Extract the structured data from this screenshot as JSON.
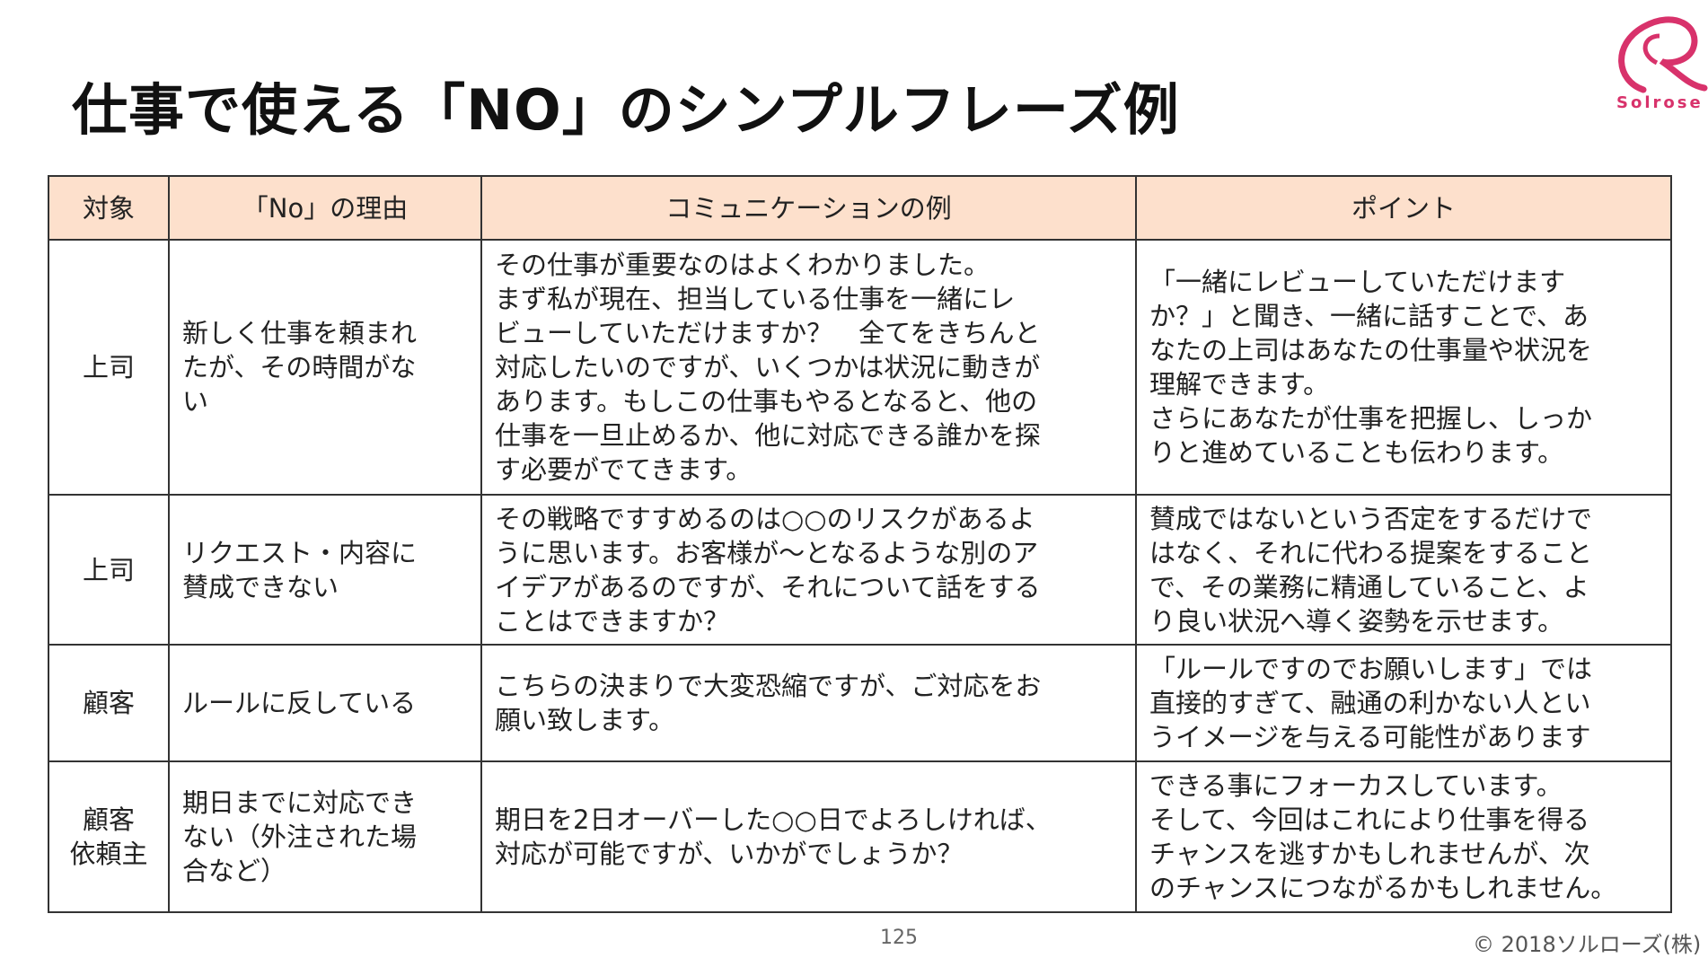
{
  "title": "仕事で使える「NO」のシンプルフレーズ例",
  "logo": {
    "text": "Solrose",
    "color": "#d8326b"
  },
  "table": {
    "header_bg": "#fde0cc",
    "headers": [
      "対象",
      "「No」の理由",
      "コミュニケーションの例",
      "ポイント"
    ],
    "rows": [
      [
        "上司",
        "新しく仕事を頼まれ\nたが、その時間がな\nい",
        "その仕事が重要なのはよくわかりました。\nまず私が現在、担当している仕事を一緒にレ\nビューしていただけますか？　全てをきちんと\n対応したいのですが、いくつかは状況に動きが\nあります。もしこの仕事もやるとなると、他の\n仕事を一旦止めるか、他に対応できる誰かを探\nす必要がでてきます。",
        "「一緒にレビューしていただけます\nか？」と聞き、一緒に話すことで、あ\nなたの上司はあなたの仕事量や状況を\n理解できます。\nさらにあなたが仕事を把握し、しっか\nりと進めていることも伝わります。"
      ],
      [
        "上司",
        "リクエスト・内容に\n賛成できない",
        "その戦略ですすめるのは○○のリスクがあるよ\nうに思います。お客様が～となるような別のア\nイデアがあるのですが、それについて話をする\nことはできますか？",
        "賛成ではないという否定をするだけで\nはなく、それに代わる提案をすること\nで、その業務に精通していること、よ\nり良い状況へ導く姿勢を示せます。"
      ],
      [
        "顧客",
        "ルールに反している",
        "こちらの決まりで大変恐縮ですが、ご対応をお\n願い致します。",
        "「ルールですのでお願いします」では\n直接的すぎて、融通の利かない人とい\nうイメージを与える可能性があります"
      ],
      [
        "顧客\n依頼主",
        "期日までに対応でき\nない（外注された場\n合など）",
        "期日を2日オーバーした○○日でよろしければ、\n対応が可能ですが、いかがでしょうか？",
        "できる事にフォーカスしています。\nそして、今回はこれにより仕事を得る\nチャンスを逃すかもしれませんが、次\nのチャンスにつながるかもしれません。"
      ]
    ]
  },
  "footer": {
    "page": "125",
    "copyright": "© 2018ソルローズ(株)"
  }
}
